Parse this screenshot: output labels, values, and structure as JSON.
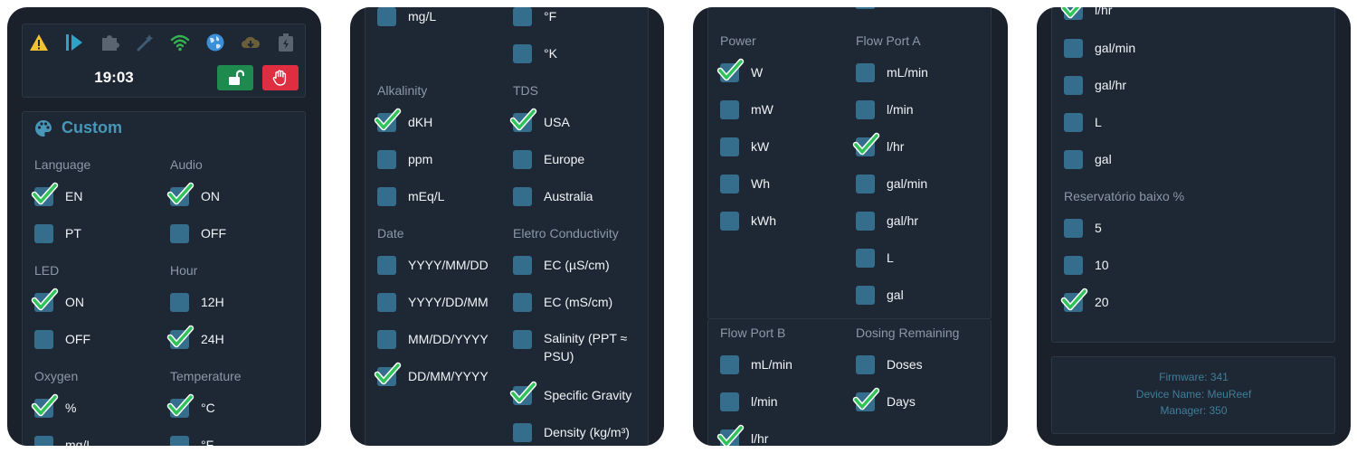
{
  "screen1": {
    "status_icons": [
      "warning-icon",
      "play-icon",
      "puzzle-icon",
      "wand-icon",
      "wifi-icon",
      "globe-icon",
      "cloud-download-icon",
      "battery-icon"
    ],
    "clock": "19:03",
    "buttons": {
      "unlock": "unlock-button",
      "stop": "stop-button"
    },
    "title": "Custom",
    "groups": {
      "language": {
        "label": "Language",
        "options": [
          {
            "text": "EN",
            "checked": true
          },
          {
            "text": "PT",
            "checked": false
          }
        ]
      },
      "audio": {
        "label": "Audio",
        "options": [
          {
            "text": "ON",
            "checked": true
          },
          {
            "text": "OFF",
            "checked": false
          }
        ]
      },
      "led": {
        "label": "LED",
        "options": [
          {
            "text": "ON",
            "checked": true
          },
          {
            "text": "OFF",
            "checked": false
          }
        ]
      },
      "hour": {
        "label": "Hour",
        "options": [
          {
            "text": "12H",
            "checked": false
          },
          {
            "text": "24H",
            "checked": true
          }
        ]
      },
      "oxygen": {
        "label": "Oxygen",
        "options": [
          {
            "text": "%",
            "checked": true
          },
          {
            "text": "mg/L",
            "checked": false
          }
        ]
      },
      "temperature": {
        "label": "Temperature",
        "options": [
          {
            "text": "°C",
            "checked": true
          },
          {
            "text": "°F",
            "checked": false
          }
        ]
      }
    }
  },
  "screen2": {
    "top_left": {
      "text": "mg/L",
      "checked": false
    },
    "top_right": [
      {
        "text": "°F",
        "checked": false
      },
      {
        "text": "°K",
        "checked": false
      }
    ],
    "alkalinity": {
      "label": "Alkalinity",
      "options": [
        {
          "text": "dKH",
          "checked": true
        },
        {
          "text": "ppm",
          "checked": false
        },
        {
          "text": "mEq/L",
          "checked": false
        }
      ]
    },
    "tds": {
      "label": "TDS",
      "options": [
        {
          "text": "USA",
          "checked": true
        },
        {
          "text": "Europe",
          "checked": false
        },
        {
          "text": "Australia",
          "checked": false
        }
      ]
    },
    "date": {
      "label": "Date",
      "options": [
        {
          "text": "YYYY/MM/DD",
          "checked": false
        },
        {
          "text": "YYYY/DD/MM",
          "checked": false
        },
        {
          "text": "MM/DD/YYYY",
          "checked": false
        },
        {
          "text": "DD/MM/YYYY",
          "checked": true
        }
      ]
    },
    "eletro": {
      "label": "Eletro Conductivity",
      "options": [
        {
          "text": "EC (µS/cm)",
          "checked": false
        },
        {
          "text": "EC (mS/cm)",
          "checked": false
        },
        {
          "text": "Salinity (PPT ≈ PSU)",
          "checked": false
        },
        {
          "text": "Specific Gravity",
          "checked": true
        },
        {
          "text": "Density (kg/m³)",
          "checked": false
        }
      ]
    }
  },
  "screen3": {
    "power": {
      "label": "Power",
      "options": [
        {
          "text": "W",
          "checked": true
        },
        {
          "text": "mW",
          "checked": false
        },
        {
          "text": "kW",
          "checked": false
        },
        {
          "text": "Wh",
          "checked": false
        },
        {
          "text": "kWh",
          "checked": false
        }
      ]
    },
    "flow_a": {
      "label": "Flow Port A",
      "options": [
        {
          "text": "mL/min",
          "checked": false
        },
        {
          "text": "l/min",
          "checked": false
        },
        {
          "text": "l/hr",
          "checked": true
        },
        {
          "text": "gal/min",
          "checked": false
        },
        {
          "text": "gal/hr",
          "checked": false
        },
        {
          "text": "L",
          "checked": false
        },
        {
          "text": "gal",
          "checked": false
        }
      ]
    },
    "flow_b": {
      "label": "Flow Port B",
      "options": [
        {
          "text": "mL/min",
          "checked": false
        },
        {
          "text": "l/min",
          "checked": false
        },
        {
          "text": "l/hr",
          "checked": true
        }
      ]
    },
    "dosing": {
      "label": "Dosing Remaining",
      "options": [
        {
          "text": "Doses",
          "checked": false
        },
        {
          "text": "Days",
          "checked": true
        }
      ]
    }
  },
  "screen4": {
    "flow_tail": [
      {
        "text": "l/hr",
        "checked": true
      },
      {
        "text": "gal/min",
        "checked": false
      },
      {
        "text": "gal/hr",
        "checked": false
      },
      {
        "text": "L",
        "checked": false
      },
      {
        "text": "gal",
        "checked": false
      }
    ],
    "reservoir": {
      "label": "Reservatório baixo %",
      "options": [
        {
          "text": "5",
          "checked": false
        },
        {
          "text": "10",
          "checked": false
        },
        {
          "text": "20",
          "checked": true
        }
      ]
    },
    "footer": {
      "firmware": "Firmware: 341",
      "device": "Device Name: MeuReef",
      "manager": "Manager: 350"
    }
  },
  "colors": {
    "accent": "#4896b8",
    "checkbox": "#356e8c",
    "check": "#30c35a",
    "panel": "#1e2835",
    "background": "#1b212a",
    "unlock": "#1f8a4d",
    "stop": "#df2e3f"
  }
}
